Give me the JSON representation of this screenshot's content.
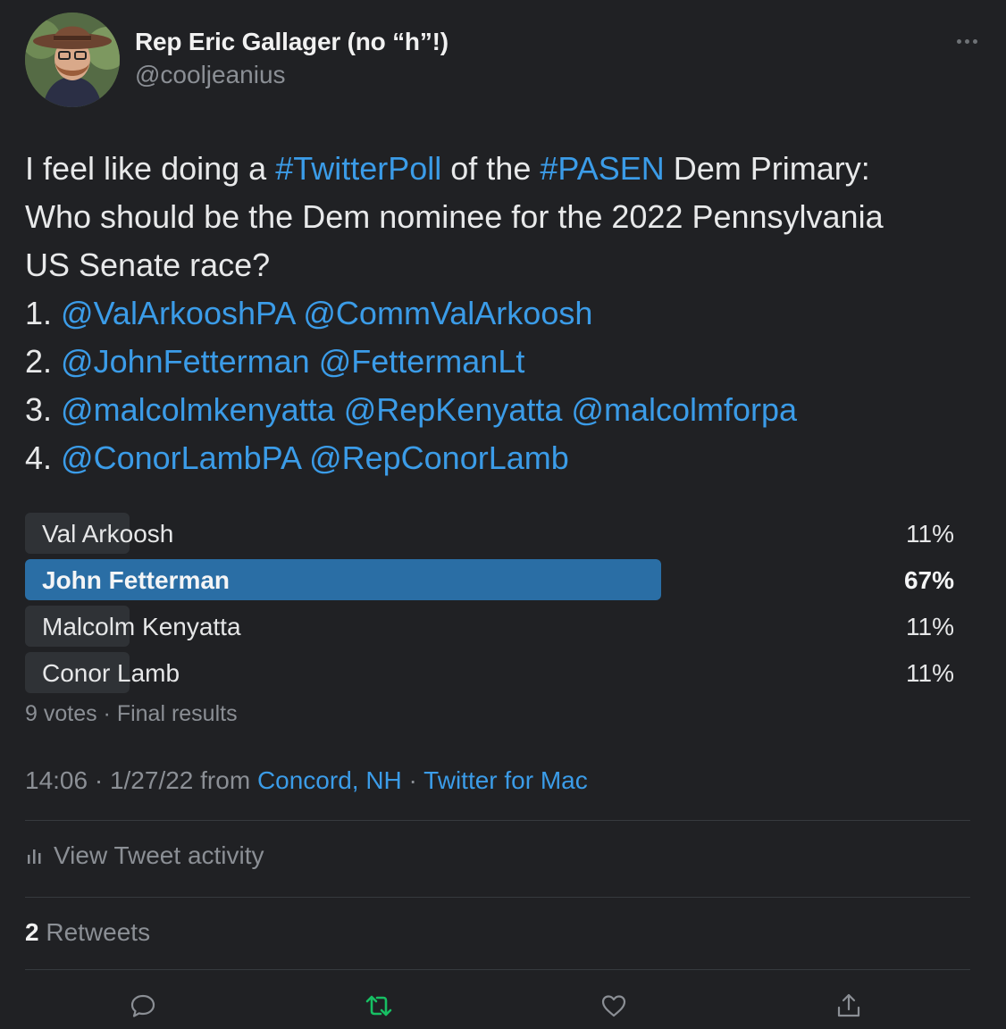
{
  "author": {
    "name": "Rep Eric Gallager (no “h”!)",
    "handle": "@cooljeanius"
  },
  "tweet": {
    "lines": [
      [
        {
          "t": "I feel like doing a "
        },
        {
          "t": "#TwitterPoll",
          "link": true
        },
        {
          "t": " of the "
        },
        {
          "t": "#PASEN",
          "link": true
        },
        {
          "t": " Dem Primary:"
        }
      ],
      [
        {
          "t": "Who should be the Dem nominee for the 2022 Pennsylvania"
        }
      ],
      [
        {
          "t": "US Senate race?"
        }
      ],
      [
        {
          "t": "1. "
        },
        {
          "t": "@ValArkooshPA",
          "link": true
        },
        {
          "t": " "
        },
        {
          "t": "@CommValArkoosh",
          "link": true
        }
      ],
      [
        {
          "t": "2. "
        },
        {
          "t": "@JohnFetterman",
          "link": true
        },
        {
          "t": " "
        },
        {
          "t": "@FettermanLt",
          "link": true
        }
      ],
      [
        {
          "t": "3. "
        },
        {
          "t": "@malcolmkenyatta",
          "link": true
        },
        {
          "t": " "
        },
        {
          "t": "@RepKenyatta",
          "link": true
        },
        {
          "t": " "
        },
        {
          "t": "@malcolmforpa",
          "link": true
        }
      ],
      [
        {
          "t": "4. "
        },
        {
          "t": "@ConorLambPA",
          "link": true
        },
        {
          "t": " "
        },
        {
          "t": "@RepConorLamb",
          "link": true
        }
      ]
    ]
  },
  "poll": {
    "options": [
      {
        "label": "Val Arkoosh",
        "pct_text": "11%",
        "percent": 11,
        "winner": false
      },
      {
        "label": "John Fetterman",
        "pct_text": "67%",
        "percent": 67,
        "winner": true
      },
      {
        "label": "Malcolm Kenyatta",
        "pct_text": "11%",
        "percent": 11,
        "winner": false
      },
      {
        "label": "Conor Lamb",
        "pct_text": "11%",
        "percent": 11,
        "winner": false
      }
    ],
    "meta": "9 votes · Final results",
    "winner_color": "#2a6ea5",
    "bar_color": "#2f3236"
  },
  "timestamp": {
    "time_date": "14:06 · 1/27/22 from ",
    "location": "Concord, NH",
    "separator": " · ",
    "source": "Twitter for Mac"
  },
  "activity": {
    "label": "View Tweet activity"
  },
  "retweets": {
    "count": "2",
    "label": " Retweets"
  },
  "icons": {
    "more": "more-dots-icon",
    "activity": "bar-chart-icon",
    "reply": "reply-icon",
    "retweet": "retweet-icon",
    "like": "heart-icon",
    "share": "share-icon"
  },
  "colors": {
    "background": "#202124",
    "link": "#3b9ce8",
    "retweet_active": "#17bf63",
    "muted": "#8b8f95"
  }
}
